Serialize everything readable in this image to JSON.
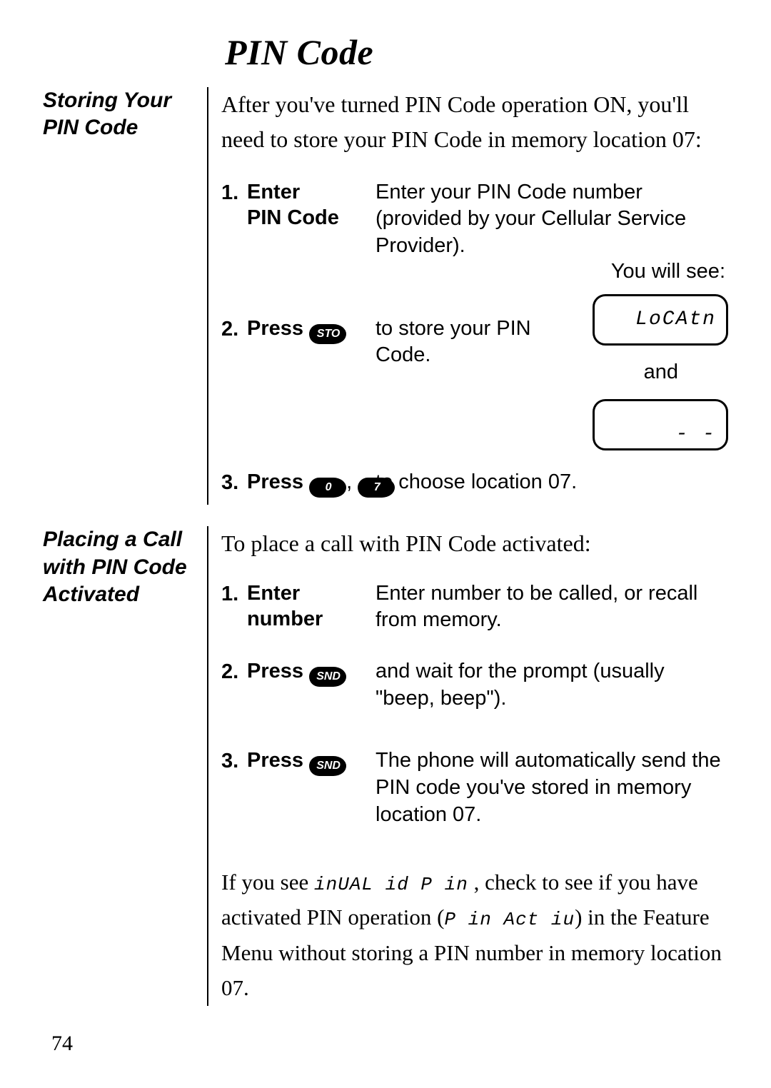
{
  "title": "PIN Code",
  "page_number": "74",
  "section1": {
    "side": "Storing Your PIN Code",
    "intro": "After you've turned PIN Code operation ON, you'll need to store your PIN Code in memory location 07:",
    "steps": [
      {
        "num": "1.",
        "action_bold1": "Enter",
        "action_bold2": "PIN Code",
        "desc": "Enter your PIN Code number (provided by your Cellular Service Provider)."
      },
      {
        "num": "2.",
        "action_bold1": "Press",
        "key": "STO",
        "desc": "to store your PIN Code."
      },
      {
        "num": "3.",
        "action_bold1": "Press",
        "key1": "0",
        "comma": ",",
        "key2": "7",
        "desc": "to choose location 07."
      }
    ],
    "aside": {
      "lbl": "You will see:",
      "disp1": "LoCAtn",
      "and": "and",
      "disp2": "- -"
    }
  },
  "section2": {
    "side": "Placing a Call with PIN Code Activated",
    "intro": "To place a call with PIN Code activated:",
    "steps": [
      {
        "num": "1.",
        "action_bold1": "Enter",
        "action_bold2": "number",
        "desc": "Enter number to be called, or recall from memory."
      },
      {
        "num": "2.",
        "action_bold1": "Press",
        "key": "SND",
        "desc": "and wait for the prompt (usually \"beep, beep\")."
      },
      {
        "num": "3.",
        "action_bold1": "Press",
        "key": "SND",
        "desc": "The phone will automatically send the PIN code you've stored in memory location 07."
      }
    ],
    "note_a": "If you see ",
    "note_seg1": "inUAL id P in",
    "note_b": " , check to see if you have acti­vated PIN operation (",
    "note_seg2": "P in  Act iu",
    "note_c": ") in the Feature Menu without storing a PIN number in memory location 07."
  }
}
